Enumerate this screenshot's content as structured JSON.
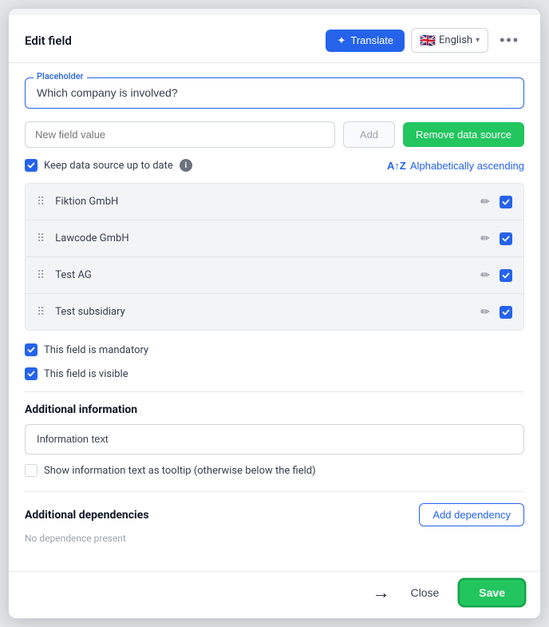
{
  "modal": {
    "title": "Edit field",
    "translate_label": "Translate",
    "language": "English",
    "dots": "•••"
  },
  "placeholder": {
    "label": "Placeholder",
    "value": "Which company is involved?"
  },
  "add_value": {
    "input_placeholder": "New field value",
    "add_label": "Add",
    "remove_label": "Remove data source"
  },
  "datasource": {
    "keep_label": "Keep data source up to date",
    "sort_label": "Alphabetically ascending"
  },
  "items": [
    {
      "name": "Fiktion GmbH"
    },
    {
      "name": "Lawcode GmbH"
    },
    {
      "name": "Test AG"
    },
    {
      "name": "Test subsidiary"
    }
  ],
  "checkboxes": {
    "mandatory_label": "This field is mandatory",
    "visible_label": "This field is visible"
  },
  "additional_info": {
    "title": "Additional information",
    "input_value": "Information text",
    "tooltip_label": "Show information text as tooltip (otherwise below the field)"
  },
  "dependencies": {
    "title": "Additional dependencies",
    "add_label": "Add dependency",
    "empty_label": "No dependence present"
  },
  "footer": {
    "close_label": "Close",
    "save_label": "Save"
  },
  "icons": {
    "translate": "⟲",
    "flag": "🇬🇧",
    "chevron": "▾",
    "drag": "⠿",
    "edit": "✏",
    "check": "✓",
    "info": "i",
    "az": "AZ",
    "arrow": "→"
  }
}
